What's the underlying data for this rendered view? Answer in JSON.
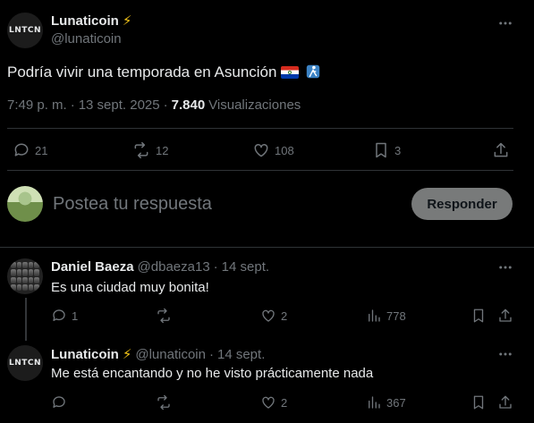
{
  "post": {
    "author_name": "Lunaticoin",
    "author_badge": "⚡",
    "author_handle": "@lunaticoin",
    "avatar_text": "LNTCN",
    "text": "Podría vivir una temporada en Asunción",
    "emoji_flag": "paraguay-flag-icon",
    "emoji_extra": "person-walking-icon",
    "time": "7:49 p. m.",
    "sep1": "·",
    "date": "13 sept. 2025",
    "sep2": "·",
    "views_count": "7.840",
    "views_label": "Visualizaciones",
    "actions": {
      "replies": "21",
      "reposts": "12",
      "likes": "108",
      "bookmarks": "3"
    }
  },
  "composer": {
    "placeholder": "Postea tu respuesta",
    "button": "Responder"
  },
  "replies": [
    {
      "name": "Daniel Baeza",
      "handle": "@dbaeza13",
      "sep": "·",
      "date": "14 sept.",
      "text": "Es una ciudad muy bonita!",
      "replies": "1",
      "reposts": "",
      "likes": "2",
      "views": "778"
    },
    {
      "name": "Lunaticoin",
      "badge": "⚡",
      "handle": "@lunaticoin",
      "sep": "·",
      "date": "14 sept.",
      "avatar_text": "LNTCN",
      "text": "Me está encantando y no he visto prácticamente nada",
      "replies": "",
      "reposts": "",
      "likes": "2",
      "views": "367"
    }
  ],
  "colors": {
    "background": "#000000",
    "text": "#e7e9ea",
    "muted": "#71767b",
    "divider": "#2f3336",
    "button_bg": "#787a7a"
  }
}
